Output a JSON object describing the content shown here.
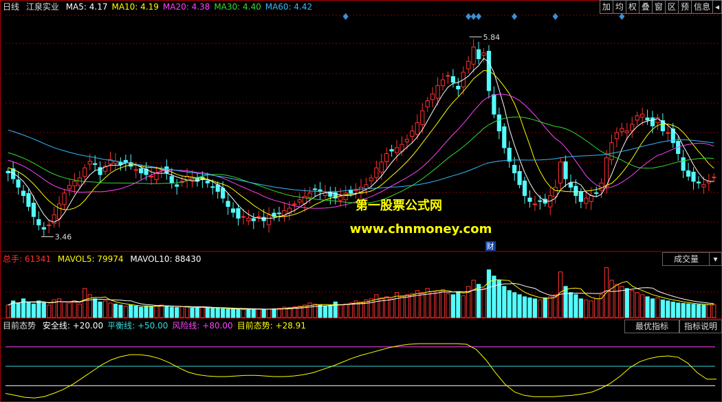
{
  "main_panel": {
    "period_label": "日线",
    "stock_name": "江泉实业",
    "ma_items": [
      {
        "label": "MA5: 4.17",
        "color": "#ffffff"
      },
      {
        "label": "MA10: 4.19",
        "color": "#ffff00"
      },
      {
        "label": "MA20: 4.38",
        "color": "#ff44ff"
      },
      {
        "label": "MA30: 4.40",
        "color": "#33dd33"
      },
      {
        "label": "MA60: 4.42",
        "color": "#33bbff"
      }
    ],
    "high_label": "5.84",
    "low_label": "3.46",
    "watermark_cn": "第一股票公式网",
    "watermark_url": "www.chnmoney.com",
    "finance_marker": "财"
  },
  "toolbar": {
    "buttons": [
      "加",
      "均",
      "权",
      "叠",
      "窗",
      "区",
      "预",
      "信息"
    ],
    "arrow_icon": "collapse-arrow-icon"
  },
  "volume_panel": {
    "total_label": "总手:",
    "total_value": "61341",
    "mavol5": "MAVOL5: 79974",
    "mavol10": "MAVOL10: 88430",
    "dropdown_label": "成交量",
    "dropdown_icon": "dropdown-arrow-icon"
  },
  "indicator_panel": {
    "name": "目前态势",
    "items": [
      {
        "label": "安全线: +20.00",
        "color": "#ffffff"
      },
      {
        "label": "平衡线: +50.00",
        "color": "#33dddd"
      },
      {
        "label": "风险线: +80.00",
        "color": "#ff44ff"
      },
      {
        "label": "目前态势: +28.91",
        "color": "#ffff00"
      }
    ],
    "button_best": "最优指标",
    "button_help": "指标说明"
  },
  "colors": {
    "up": "#ff3232",
    "down": "#54fcfc",
    "grid": "#8b0000",
    "ma5": "#ffffff",
    "ma10": "#ffff00",
    "ma20": "#ff44ff",
    "ma30": "#33dd33",
    "ma60": "#33bbff"
  },
  "chart_data": [
    {
      "type": "candlestick",
      "title": "江泉实业 日线",
      "ylim": [
        3.3,
        6.1
      ],
      "annotations": {
        "high": 5.84,
        "low": 3.46
      },
      "closes": [
        4.22,
        4.15,
        4.05,
        3.95,
        3.82,
        3.7,
        3.6,
        3.55,
        3.6,
        3.72,
        3.85,
        3.98,
        4.07,
        4.12,
        4.16,
        4.28,
        4.36,
        4.32,
        4.2,
        4.3,
        4.38,
        4.36,
        4.32,
        4.34,
        4.3,
        4.26,
        4.22,
        4.2,
        4.18,
        4.22,
        4.26,
        4.22,
        4.1,
        4.06,
        4.12,
        4.18,
        4.16,
        4.12,
        4.14,
        4.1,
        4.05,
        4.0,
        3.92,
        3.82,
        3.75,
        3.68,
        3.7,
        3.68,
        3.65,
        3.7,
        3.65,
        3.72,
        3.7,
        3.74,
        3.77,
        3.8,
        3.85,
        3.9,
        3.94,
        3.98,
        4.02,
        4.0,
        3.98,
        3.94,
        3.92,
        3.94,
        3.98,
        3.98,
        4.02,
        4.05,
        4.08,
        4.16,
        4.28,
        4.35,
        4.45,
        4.48,
        4.52,
        4.56,
        4.62,
        4.72,
        4.82,
        4.96,
        5.08,
        5.16,
        5.26,
        5.33,
        5.38,
        5.3,
        5.22,
        5.42,
        5.55,
        5.72,
        5.58,
        5.65,
        5.2,
        4.92,
        4.72,
        4.52,
        4.36,
        4.22,
        4.08,
        3.95,
        3.88,
        3.85,
        3.88,
        3.86,
        3.95,
        4.05,
        4.35,
        4.15,
        4.05,
        3.95,
        3.88,
        3.92,
        3.95,
        3.98,
        4.1,
        4.4,
        4.58,
        4.7,
        4.75,
        4.72,
        4.8,
        4.9,
        4.92,
        4.85,
        4.78,
        4.88,
        4.72,
        4.7,
        4.58,
        4.45,
        4.25,
        4.18,
        4.12,
        4.1,
        4.08,
        4.12,
        4.17
      ]
    },
    {
      "type": "bar",
      "title": "成交量",
      "mavol5": 79974,
      "mavol10": 88430,
      "last_value": 61341,
      "values": [
        60000,
        80000,
        70000,
        90000,
        75000,
        65000,
        80000,
        70000,
        60000,
        85000,
        90000,
        75000,
        70000,
        80000,
        65000,
        140000,
        110000,
        90000,
        75000,
        80000,
        70000,
        65000,
        60000,
        55000,
        60000,
        55000,
        50000,
        55000,
        52000,
        58000,
        60000,
        55000,
        50000,
        48000,
        52000,
        50000,
        45000,
        48000,
        50000,
        46000,
        44000,
        45000,
        42000,
        40000,
        42000,
        40000,
        38000,
        40000,
        42000,
        40000,
        38000,
        40000,
        42000,
        45000,
        50000,
        48000,
        52000,
        55000,
        60000,
        70000,
        65000,
        60000,
        55000,
        58000,
        75000,
        60000,
        65000,
        70000,
        80000,
        75000,
        85000,
        90000,
        110000,
        95000,
        100000,
        90000,
        120000,
        105000,
        110000,
        115000,
        130000,
        120000,
        140000,
        125000,
        130000,
        135000,
        115000,
        110000,
        125000,
        105000,
        150000,
        180000,
        160000,
        140000,
        230000,
        200000,
        180000,
        150000,
        130000,
        120000,
        110000,
        100000,
        95000,
        90000,
        85000,
        95000,
        100000,
        110000,
        220000,
        150000,
        120000,
        110000,
        90000,
        85000,
        80000,
        90000,
        110000,
        240000,
        180000,
        160000,
        150000,
        140000,
        130000,
        120000,
        110000,
        100000,
        90000,
        95000,
        85000,
        80000,
        75000,
        70000,
        68000,
        66000,
        64000,
        62000,
        60000,
        62000,
        61341
      ]
    },
    {
      "type": "line",
      "title": "目前态势",
      "ylim": [
        0,
        100
      ],
      "reference_lines": {
        "安全线": 20,
        "平衡线": 50,
        "风险线": 80
      },
      "values": [
        8,
        5,
        2,
        1,
        3,
        8,
        14,
        22,
        32,
        42,
        52,
        60,
        65,
        68,
        68,
        66,
        62,
        56,
        48,
        41,
        37,
        35,
        34,
        34,
        35,
        36,
        36,
        35,
        34,
        34,
        35,
        37,
        40,
        45,
        50,
        56,
        62,
        67,
        71,
        75,
        79,
        82,
        84,
        85,
        85,
        85,
        85,
        85,
        84,
        76,
        60,
        40,
        22,
        10,
        5,
        3,
        3,
        3,
        4,
        5,
        7,
        10,
        16,
        24,
        35,
        48,
        57,
        62,
        65,
        66,
        64,
        55,
        40,
        30,
        30
      ],
      "last_value": 28.91
    }
  ]
}
